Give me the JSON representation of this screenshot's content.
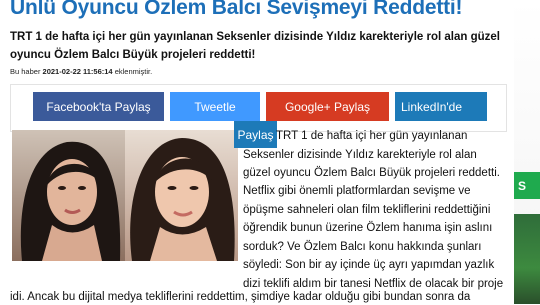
{
  "article": {
    "title": "Ünlü Oyuncu Özlem Balcı Sevişmeyi Reddetti!",
    "lead": "TRT 1 de hafta içi her gün yayınlanan Seksenler dizisinde Yıldız karekteriyle rol alan güzel oyuncu Özlem Balcı Büyük projeleri reddetti!",
    "meta_prefix": "Bu haber",
    "meta_date": "2021-02-22 11:56:14",
    "meta_suffix": "eklenmiştir.",
    "paragraph1": "TRT 1 de hafta içi her gün yayınlanan Seksenler dizisinde Yıldız karekteriyle rol alan güzel oyuncu Özlem Balcı Büyük projeleri reddetti.",
    "paragraph2": "Netflix gibi önemli platformlardan sevişme ve öpüşme sahneleri olan film tekliflerini reddettiğini öğrendik bunun üzerine Özlem hanıma işin aslını sorduk? Ve Özlem Balcı konu hakkında şunları söyledi: Son bir ay içinde üç ayrı yapımdan yazlık dizi teklifi aldım bir tanesi Netflix de olacak bir proje",
    "last_line": "idi. Ancak bu dijital medya tekliflerini reddettim, şimdiye kadar olduğu gibi bundan sonra da"
  },
  "share": {
    "facebook": "Facebook'ta Paylaş",
    "twitter": "Tweetle",
    "google": "Google+ Paylaş",
    "linkedin": "LinkedIn'de",
    "linkedin_overflow": "Paylaş"
  },
  "sidebar": {
    "green_label": "S"
  },
  "colors": {
    "title": "#1d6fb8",
    "facebook": "#3b5a9a",
    "twitter": "#4099ff",
    "google": "#d63b22",
    "linkedin": "#1d7ab8",
    "sidebar_green": "#1faa4e"
  }
}
